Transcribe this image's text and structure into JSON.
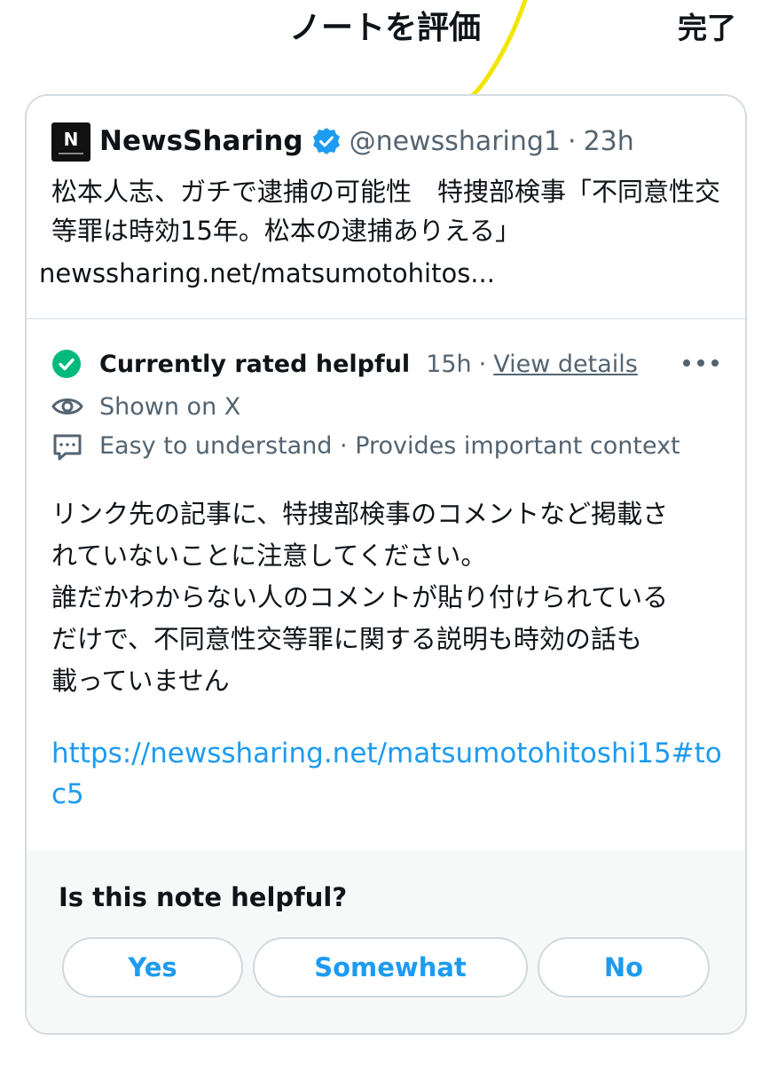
{
  "header": {
    "title": "ノートを評価",
    "done_label": "完了"
  },
  "post": {
    "avatar_letter": "N",
    "author": "NewsSharing",
    "handle": "@newssharing1",
    "separator": "·",
    "time": "23h",
    "text": "松本人志、ガチで逮捕の可能性　特捜部検事「不同意性交等罪は時効15年。松本の逮捕ありえる」",
    "link": "newssharing.net/matsumotohitos..."
  },
  "note": {
    "status_label": "Currently rated helpful",
    "status_time": "15h",
    "separator": "·",
    "details_label": "View details",
    "shown_label": "Shown on X",
    "tags_label": "Easy to understand · Provides important context",
    "text_lines": [
      "リンク先の記事に、特捜部検事のコメントなど掲載さ",
      "れていないことに注意してください。",
      "誰だかわからない人のコメントが貼り付けられている",
      "だけで、不同意性交等罪に関する説明も時効の話も",
      "載っていません"
    ],
    "link": "https://newssharing.net/matsumotohitoshi15#toc5"
  },
  "rating": {
    "question": "Is this note helpful?",
    "buttons": [
      "Yes",
      "Somewhat",
      "No"
    ]
  },
  "colors": {
    "accent": "#1d9bf0",
    "helpful_green": "#00ba7c",
    "muted": "#536471",
    "annotation_yellow": "#f2e600"
  }
}
